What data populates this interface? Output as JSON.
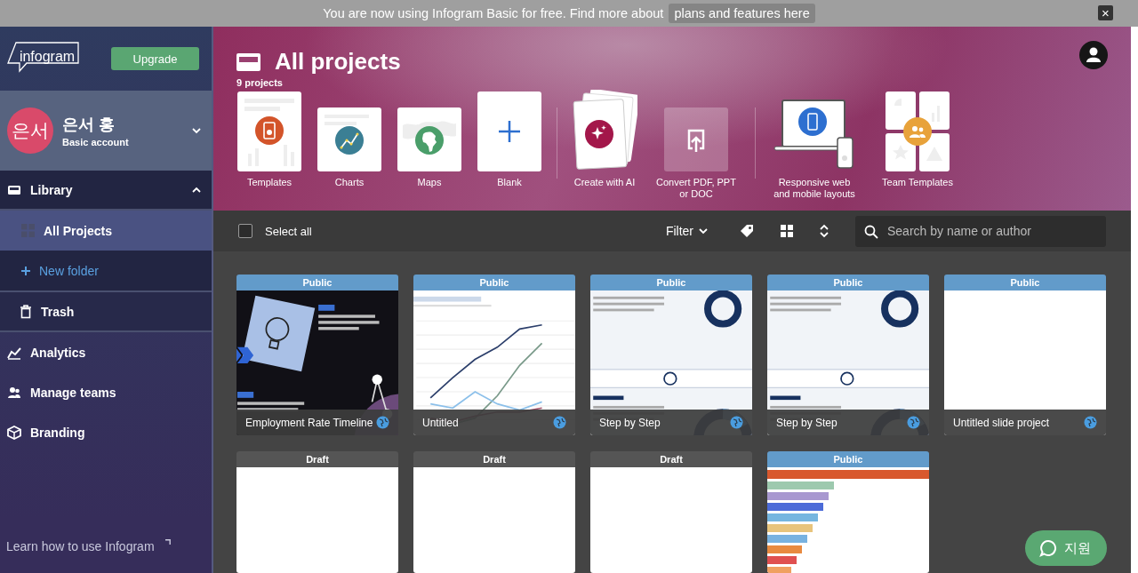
{
  "banner": {
    "text": "You are now using Infogram Basic for free. Find more about",
    "link": "plans and features here",
    "close": "×"
  },
  "sidebar": {
    "logo": "infogram",
    "upgrade": "Upgrade",
    "user": {
      "initials": "은서",
      "name": "은서 홍",
      "plan": "Basic account"
    },
    "nav": [
      {
        "label": "Library",
        "selected": false,
        "expanded": true,
        "children": [
          {
            "label": "All Projects",
            "kind": "folder",
            "selected": true
          },
          {
            "label": "New folder",
            "kind": "add",
            "selected": false
          },
          {
            "label": "Trash",
            "kind": "trash",
            "selected": false
          }
        ]
      },
      {
        "label": "Analytics",
        "selected": false
      },
      {
        "label": "Manage teams",
        "selected": false
      },
      {
        "label": "Branding",
        "selected": false
      }
    ],
    "help_link": "Learn how to use Infogram"
  },
  "header": {
    "title": "All projects",
    "count": "9 projects",
    "create": [
      {
        "label": "Templates"
      },
      {
        "label": "Charts"
      },
      {
        "label": "Maps"
      },
      {
        "label": "Blank"
      },
      {
        "label": "Create with AI"
      },
      {
        "label": "Convert PDF, PPT or DOC"
      },
      {
        "label": "Responsive web and mobile layouts"
      },
      {
        "label": "Team Templates"
      }
    ]
  },
  "toolbar": {
    "select_all": {
      "label": "Select all",
      "checked": false
    },
    "filter": "Filter",
    "search": {
      "placeholder": "Search by name or author"
    }
  },
  "projects": [
    {
      "status": "Public",
      "public": true,
      "title": "Employment Rate Timeline",
      "kind": "timeline"
    },
    {
      "status": "Public",
      "public": true,
      "title": "Untitled",
      "kind": "line"
    },
    {
      "status": "Public",
      "public": true,
      "title": "Step by Step",
      "kind": "steps"
    },
    {
      "status": "Public",
      "public": true,
      "title": "Step by Step",
      "kind": "steps"
    },
    {
      "status": "Public",
      "public": true,
      "title": "Untitled slide project",
      "kind": "blank"
    },
    {
      "status": "Draft",
      "public": false,
      "kind": "blank"
    },
    {
      "status": "Draft",
      "public": false,
      "kind": "blank"
    },
    {
      "status": "Draft",
      "public": false,
      "kind": "blank"
    },
    {
      "status": "Public",
      "public": true,
      "kind": "bars"
    }
  ],
  "chat": {
    "label": "지원"
  }
}
